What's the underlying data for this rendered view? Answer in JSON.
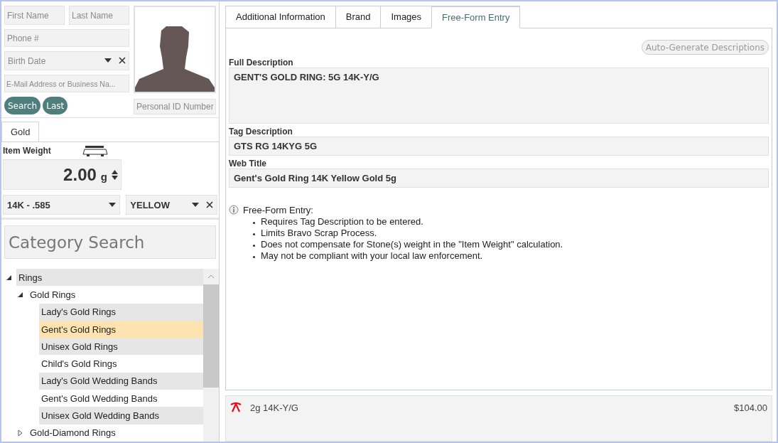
{
  "customer": {
    "first_name": {
      "placeholder": "First Name"
    },
    "last_name": {
      "placeholder": "Last Name"
    },
    "phone": {
      "placeholder": "Phone #"
    },
    "birth_date": {
      "placeholder": "Birth Date"
    },
    "email": {
      "placeholder": "E-Mail Address or Business Na..."
    },
    "buttons": [
      "Search",
      "Last"
    ],
    "personal_id": {
      "placeholder": "Personal ID Number"
    }
  },
  "left_tabs": [
    {
      "label": "Gold",
      "selected": true
    }
  ],
  "item": {
    "weight_label": "Item Weight",
    "weight": "2.00",
    "unit": "g",
    "karat": "14K - .585",
    "metal_color": "YELLOW"
  },
  "category_search": {
    "placeholder": "Category Search"
  },
  "tree": [
    {
      "label": "Rings",
      "expanded": true,
      "selected": false,
      "children": [
        {
          "label": "Gold Rings",
          "expanded": true,
          "selected": false,
          "children": [
            {
              "label": "Lady's Gold Rings",
              "selected": false
            },
            {
              "label": "Gent's Gold Rings",
              "selected": true
            },
            {
              "label": "Unisex Gold Rings",
              "selected": false
            },
            {
              "label": "Child's Gold Rings",
              "selected": false
            },
            {
              "label": "Lady's Gold Wedding Bands",
              "selected": false
            },
            {
              "label": "Gent's Gold Wedding Bands",
              "selected": false
            },
            {
              "label": "Unisex Gold Wedding Bands",
              "selected": false
            }
          ]
        },
        {
          "label": "Gold-Diamond Rings",
          "expanded": false,
          "selected": false
        }
      ]
    }
  ],
  "tabs": [
    {
      "label": "Additional Information",
      "selected": false
    },
    {
      "label": "Brand",
      "selected": false
    },
    {
      "label": "Images",
      "selected": false
    },
    {
      "label": "Free-Form Entry",
      "selected": true
    }
  ],
  "auto_generate_button": {
    "label": "Auto-Generate Descriptions",
    "disabled": true
  },
  "fields": [
    {
      "label": "Full Description",
      "value": "GENT'S GOLD RING: 5G 14K-Y/G",
      "kind": "multiline"
    },
    {
      "label": "Tag Description",
      "value": "GTS RG 14KYG 5G",
      "kind": "single"
    },
    {
      "label": "Web Title",
      "value": "Gent's Gold Ring 14K Yellow Gold 5g",
      "kind": "single"
    }
  ],
  "notice": {
    "title": "Free-Form Entry:",
    "bullets": [
      "Requires Tag Description to be entered.",
      "Limits Bravo Scrap Process.",
      "Does not compensate for Stone(s) weight in the \"Item Weight\" calculation.",
      "May not be compliant with your local law enforcement."
    ]
  },
  "summary": {
    "description": "2g 14K-Y/G",
    "price": "$104.00"
  }
}
